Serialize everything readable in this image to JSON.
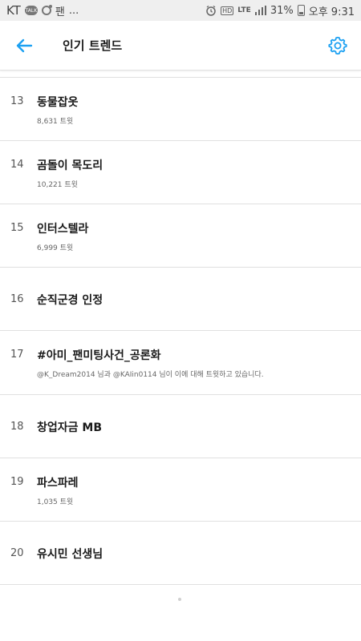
{
  "status_bar": {
    "carrier": "KT",
    "notif_talk": "TALK",
    "notif_app": "팬",
    "ellipsis": "...",
    "hd": "HD",
    "network": "LTE",
    "battery": "31%",
    "time": "오후 9:31"
  },
  "header": {
    "title": "인기 트렌드",
    "back_icon": "arrow-left-icon",
    "settings_icon": "gear-icon",
    "accent_color": "#1DA1F2"
  },
  "trends": [
    {
      "rank": "13",
      "name": "동물잡옷",
      "sub": "8,631 트윗"
    },
    {
      "rank": "14",
      "name": "곰돌이 목도리",
      "sub": "10,221 트윗"
    },
    {
      "rank": "15",
      "name": "인터스텔라",
      "sub": "6,999 트윗"
    },
    {
      "rank": "16",
      "name": "순직군경 인정",
      "sub": ""
    },
    {
      "rank": "17",
      "name": "#아미_팬미팅사건_공론화",
      "sub": "@K_Dream2014 님과 @KAIin0114 님이 이에 대해 트윗하고 있습니다."
    },
    {
      "rank": "18",
      "name": "창업자금 MB",
      "sub": ""
    },
    {
      "rank": "19",
      "name": "파스파레",
      "sub": "1,035 트윗"
    },
    {
      "rank": "20",
      "name": "유시민 선생님",
      "sub": ""
    }
  ]
}
